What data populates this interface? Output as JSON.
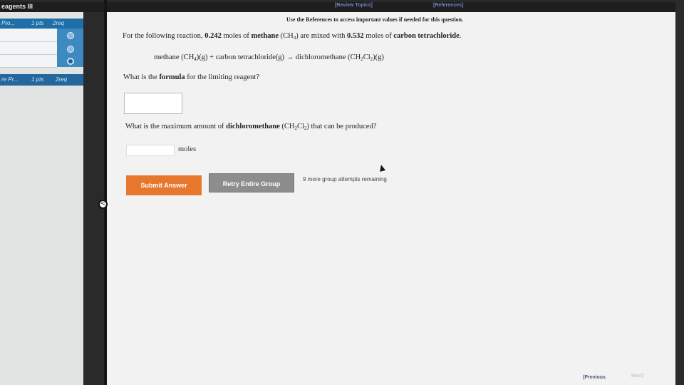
{
  "header": {
    "app_title": "eagents III",
    "review_topics": "[Review Topics]",
    "references": "[References]"
  },
  "sidebar": {
    "items": [
      {
        "name": "Pro...",
        "points": "1 pts",
        "req": "2req"
      },
      {
        "name": "re Pr...",
        "points": "1 pts",
        "req": "2req"
      }
    ]
  },
  "question": {
    "notice": "Use the References to access important values if needed for this question.",
    "intro_pre": "For the following reaction, ",
    "methane_moles": "0.242",
    "moles_of": " moles of ",
    "methane": "methane",
    "methane_formula_open": "(CH",
    "methane_sub": "4",
    "methane_formula_close": ")",
    "mixed_with": " are mixed with ",
    "ccl4_moles": "0.532",
    "ccl4": "carbon tetrachloride",
    "period": ".",
    "eq_left_open": "methane (CH",
    "eq_left_sub": "4",
    "eq_left_close": ")(g) + carbon tetrachloride(g) → dichloromethane (CH",
    "eq_r_sub1": "2",
    "eq_r_cl": "Cl",
    "eq_r_sub2": "2",
    "eq_r_close": ")(g)",
    "q_formula_pre": "What is the ",
    "q_formula_bold": "formula",
    "q_formula_post": " for the limiting reagent?",
    "formula_value": "",
    "q_max_pre": "What is the maximum amount of ",
    "q_max_bold": "dichloromethane",
    "q_max_formula_open": " (CH",
    "q_max_sub1": "2",
    "q_max_cl": "Cl",
    "q_max_sub2": "2",
    "q_max_post": ") that can be produced?",
    "moles_value": "",
    "moles_unit": "moles"
  },
  "actions": {
    "submit": "Submit Answer",
    "retry": "Retry Entire Group",
    "attempts": "9 more group attempts remaining"
  },
  "nav": {
    "collapse": "<",
    "previous": "Previous",
    "next": "Next"
  },
  "colors": {
    "submit": "#e8772e",
    "retry": "#8d8d8d",
    "sidebar_active": "#1d6fa8"
  }
}
